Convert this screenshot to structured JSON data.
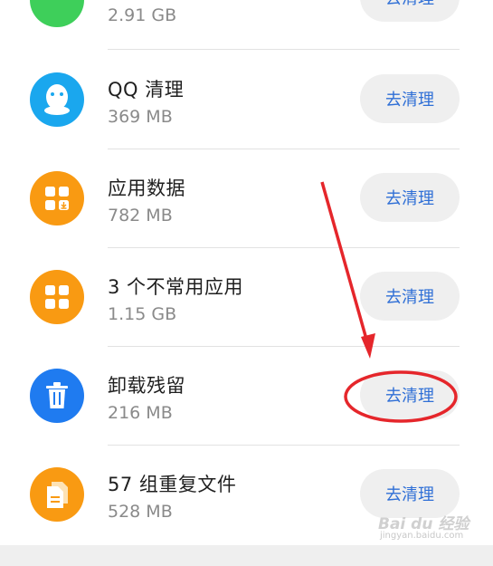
{
  "items": [
    {
      "title": "",
      "size": "2.91 GB",
      "button": "去清理",
      "icon": "green-app-icon",
      "color": "#3ecf5a"
    },
    {
      "title": "QQ 清理",
      "size": "369 MB",
      "button": "去清理",
      "icon": "qq-penguin-icon",
      "color": "#1aa7ee"
    },
    {
      "title": "应用数据",
      "size": "782 MB",
      "button": "去清理",
      "icon": "app-data-icon",
      "color": "#f99a12"
    },
    {
      "title": "3 个不常用应用",
      "size": "1.15 GB",
      "button": "去清理",
      "icon": "unused-apps-icon",
      "color": "#f99a12"
    },
    {
      "title": "卸载残留",
      "size": "216 MB",
      "button": "去清理",
      "icon": "trash-icon",
      "color": "#1f7bf0"
    },
    {
      "title": "57 组重复文件",
      "size": "528 MB",
      "button": "去清理",
      "icon": "duplicate-file-icon",
      "color": "#f99a12"
    }
  ],
  "annotation": {
    "arrow_color": "#e5262b",
    "ellipse_color": "#e5262b"
  },
  "watermark": {
    "text": "Bai du 经验",
    "sub": "jingyan.baidu.com"
  }
}
